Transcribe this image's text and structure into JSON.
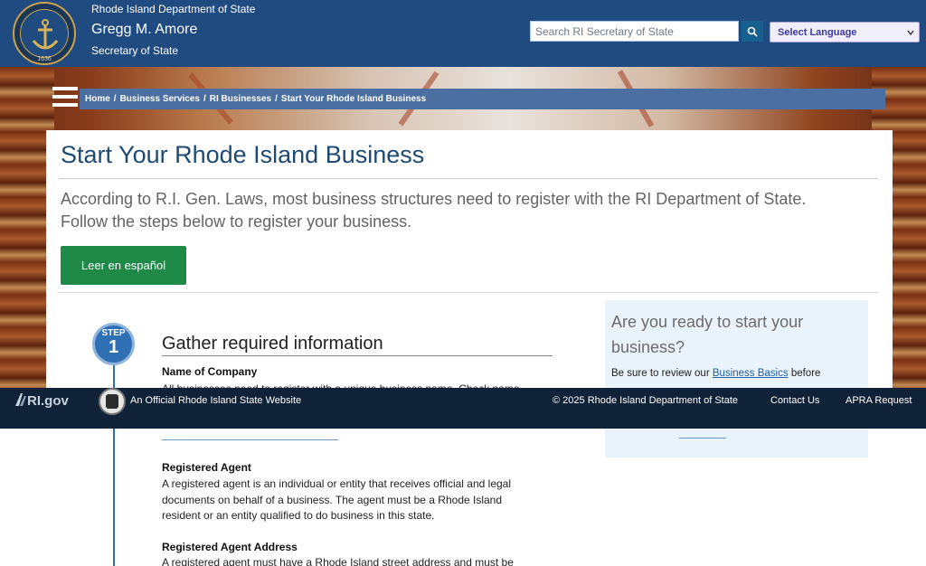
{
  "header": {
    "department": "Rhode Island Department of State",
    "official_name": "Gregg M. Amore",
    "official_title": "Secretary of State",
    "seal_year": "1636",
    "search_placeholder": "Search RI Secretary of State",
    "language_select": "Select Language"
  },
  "breadcrumb": {
    "items": [
      "Home",
      "Business Services",
      "RI Businesses",
      "Start Your Rhode Island Business"
    ]
  },
  "main": {
    "title": "Start Your Rhode Island Business",
    "intro": "According to R.I. Gen. Laws, most business structures need to register with the RI Department of State. Follow the steps below to register your business.",
    "spanish_button": "Leer en español"
  },
  "step": {
    "label": "STEP",
    "number": "1",
    "title": "Gather required information",
    "fields": [
      {
        "title": "Name of Company",
        "text": "All businesses need to register with a unique business name. Check name"
      },
      {
        "title": "Registered Agent",
        "text": "A registered agent is an individual or entity that receives official and legal documents on behalf of a business. The agent must be a Rhode Island resident or an entity qualified to do business in this state."
      },
      {
        "title": "Registered Agent Address",
        "text": "A registered agent must have a Rhode Island street address and must be"
      }
    ]
  },
  "side": {
    "title": "Are you ready to start your business?",
    "text_before": "Be sure to review our",
    "link": "Business Basics",
    "text_after": "before"
  },
  "footer": {
    "rigov": "RI.gov",
    "official_site": "An Official Rhode Island State Website",
    "copyright": "© 2025 Rhode Island Department of State",
    "contact": "Contact Us",
    "apra": "APRA Request"
  },
  "colors": {
    "header_bg": "#1f4b80",
    "breadcrumb_bg": "#4a6fa0",
    "title_color": "#1f4b73",
    "spanish_button_bg": "#1f8a47",
    "footer_bg": "#0f2238",
    "step_blue": "#2f6fb4"
  }
}
